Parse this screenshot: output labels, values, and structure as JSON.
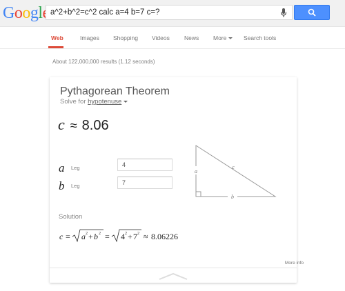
{
  "logo": {
    "letters": [
      "G",
      "o",
      "o",
      "g",
      "l",
      "e"
    ],
    "colors": [
      "#4285f4",
      "#ea4335",
      "#fbbc05",
      "#4285f4",
      "#34a853",
      "#ea4335"
    ]
  },
  "search": {
    "query": "a^2+b^2=c^2 calc a=4 b=7 c=?",
    "mic_icon": "microphone-icon",
    "button_icon": "search-icon"
  },
  "tabs": [
    {
      "label": "Web",
      "active": true
    },
    {
      "label": "Images"
    },
    {
      "label": "Shopping"
    },
    {
      "label": "Videos"
    },
    {
      "label": "News"
    },
    {
      "label": "More"
    },
    {
      "label": "Search tools"
    }
  ],
  "results_count": "About 122,000,000 results (1.12 seconds)",
  "card": {
    "title": "Pythagorean Theorem",
    "solve_for_prefix": "Solve for",
    "solve_for_link": "hypotenuse",
    "result_var": "c",
    "result_approx": "≈",
    "result_value": "8.06",
    "inputs": [
      {
        "var": "a",
        "label": "Leg",
        "value": "4"
      },
      {
        "var": "b",
        "label": "Leg",
        "value": "7"
      }
    ],
    "triangle_labels": {
      "a": "a",
      "b": "b",
      "c": "c"
    },
    "solution_label": "Solution",
    "formula": {
      "lhs": "c",
      "eq": "=",
      "approx": "≈",
      "result": "8.06226",
      "a": "a",
      "b": "b",
      "n1": "4",
      "n2": "7",
      "exp": "2",
      "plus": "+"
    },
    "more_info": "More info"
  },
  "accent_colors": {
    "tab_active": "#dd4b39",
    "search_button": "#4d90fe"
  }
}
